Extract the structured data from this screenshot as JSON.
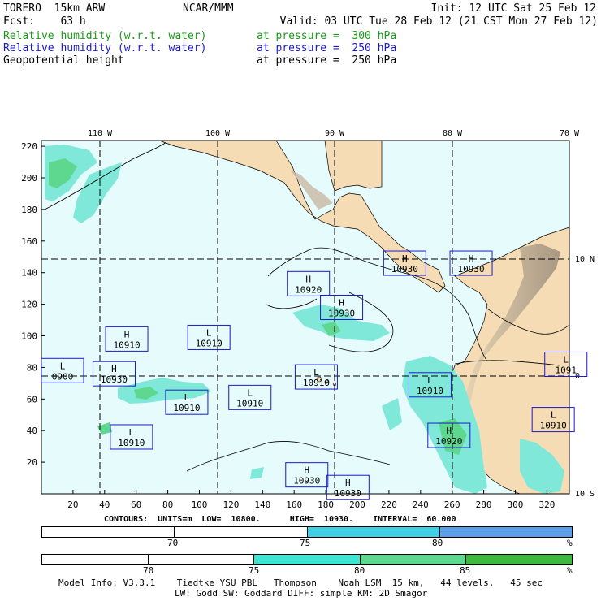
{
  "header": {
    "model": "TORERO  15km ARW",
    "org": "NCAR/MMM",
    "init": "Init: 12 UTC Sat 25 Feb 12",
    "fcst": "Fcst:    63 h",
    "valid": "Valid: 03 UTC Tue 28 Feb 12 (21 CST Mon 27 Feb 12)",
    "fields": [
      {
        "name": "Relative humidity (w.r.t. water)",
        "level": "at pressure =  300 hPa",
        "color": "#1a9a1a"
      },
      {
        "name": "Relative humidity (w.r.t. water)",
        "level": "at pressure =  250 hPa",
        "color": "#1a1acc"
      },
      {
        "name": "Geopotential height",
        "level": "at pressure =  250 hPa",
        "color": "#000000"
      }
    ]
  },
  "map": {
    "lon_labels": [
      "110 W",
      "100 W",
      "90 W",
      "80 W",
      "70 W"
    ],
    "lat_labels": [
      "10 N",
      "0",
      "10 S"
    ],
    "x_ticks": [
      "20",
      "40",
      "60",
      "80",
      "100",
      "120",
      "140",
      "160",
      "180",
      "200",
      "220",
      "240",
      "260",
      "280",
      "300",
      "320"
    ],
    "y_ticks": [
      "220",
      "200",
      "180",
      "160",
      "140",
      "120",
      "100",
      "80",
      "60",
      "40",
      "20"
    ],
    "pressure_labels": [
      {
        "type": "H",
        "value": "10920",
        "gx": 169,
        "gy": 133
      },
      {
        "type": "H",
        "value": "10930",
        "gx": 190,
        "gy": 118
      },
      {
        "type": "H",
        "value": "10930",
        "gx": 230,
        "gy": 146
      },
      {
        "type": "H",
        "value": "10930",
        "gx": 272,
        "gy": 146
      },
      {
        "type": "H",
        "value": "10910",
        "gx": 54,
        "gy": 98
      },
      {
        "type": "L",
        "value": "10910",
        "gx": 106,
        "gy": 99
      },
      {
        "type": "L",
        "value": "0900",
        "gx": 5,
        "gy": 78
      },
      {
        "type": "H",
        "value": "10930",
        "gx": 46,
        "gy": 76
      },
      {
        "type": "L",
        "value": "10910",
        "gx": 174,
        "gy": 74
      },
      {
        "type": "L",
        "value": "10910",
        "gx": 92,
        "gy": 58
      },
      {
        "type": "L",
        "value": "10910",
        "gx": 132,
        "gy": 61
      },
      {
        "type": "L",
        "value": "10910",
        "gx": 57,
        "gy": 36
      },
      {
        "type": "L",
        "value": "10910",
        "gx": 246,
        "gy": 69
      },
      {
        "type": "H",
        "value": "10920",
        "gx": 258,
        "gy": 37
      },
      {
        "type": "L",
        "value": "10910",
        "gx": 324,
        "gy": 47
      },
      {
        "type": "L",
        "value": "1091",
        "gx": 332,
        "gy": 82
      },
      {
        "type": "H",
        "value": "10930",
        "gx": 168,
        "gy": 12
      },
      {
        "type": "H",
        "value": "10930",
        "gx": 194,
        "gy": 4
      }
    ]
  },
  "contours": {
    "text": "CONTOURS:  UNITS=m  LOW=  10800.      HIGH=  10930.    INTERVAL=  60.000"
  },
  "colorbar1": {
    "labels": [
      "70",
      "75",
      "80"
    ],
    "unit": "%",
    "colors": [
      "#ffffff",
      "#ffffff",
      "#3fd0e6",
      "#5a9ee8"
    ]
  },
  "colorbar2": {
    "labels": [
      "70",
      "75",
      "80",
      "85"
    ],
    "unit": "%",
    "colors": [
      "#ffffff",
      "#ffffff",
      "#3ee6d2",
      "#5fd88f",
      "#3fb83f"
    ]
  },
  "footer": {
    "line1": "Model Info: V3.3.1    Tiedtke YSU PBL   Thompson    Noah LSM  15 km,   44 levels,   45 sec",
    "line2": "LW: Godd SW: Goddard DIFF: simple KM: 2D Smagor"
  }
}
